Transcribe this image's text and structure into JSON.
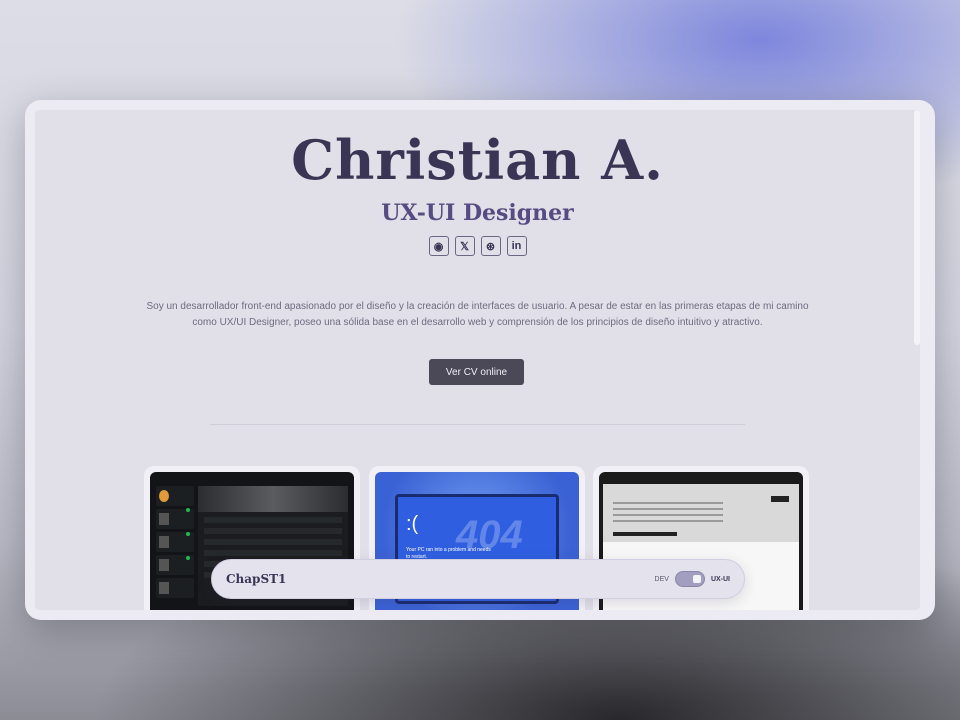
{
  "header": {
    "name": "Christian A.",
    "role": "UX-UI Designer"
  },
  "socials": [
    {
      "icon": "github-icon",
      "glyph": "◉"
    },
    {
      "icon": "x-icon",
      "glyph": "𝕏"
    },
    {
      "icon": "dribbble-icon",
      "glyph": "⊛"
    },
    {
      "icon": "linkedin-icon",
      "glyph": "in"
    }
  ],
  "bio": "Soy un desarrollador front-end apasionado por el diseño y la creación de interfaces de usuario. A pesar de estar en las primeras etapas de mi camino como UX/UI Designer, poseo una sólida base en el desarrollo web y comprensión de los principios de diseño intuitivo y atractivo.",
  "cv_button": "Ver CV online",
  "projects": [
    {
      "name": "music-app-preview"
    },
    {
      "name": "404-page-preview",
      "sad": ":(",
      "big": "404",
      "msg": "Your PC ran into a problem and needs to restart."
    },
    {
      "name": "document-preview"
    }
  ],
  "navbar": {
    "brand": "ChapST1",
    "toggle_left": "DEV",
    "toggle_right": "UX-UI",
    "toggle_state": "UX-UI"
  },
  "colors": {
    "accent": "#574c82",
    "heading": "#3a3555",
    "button": "#4b4857"
  }
}
